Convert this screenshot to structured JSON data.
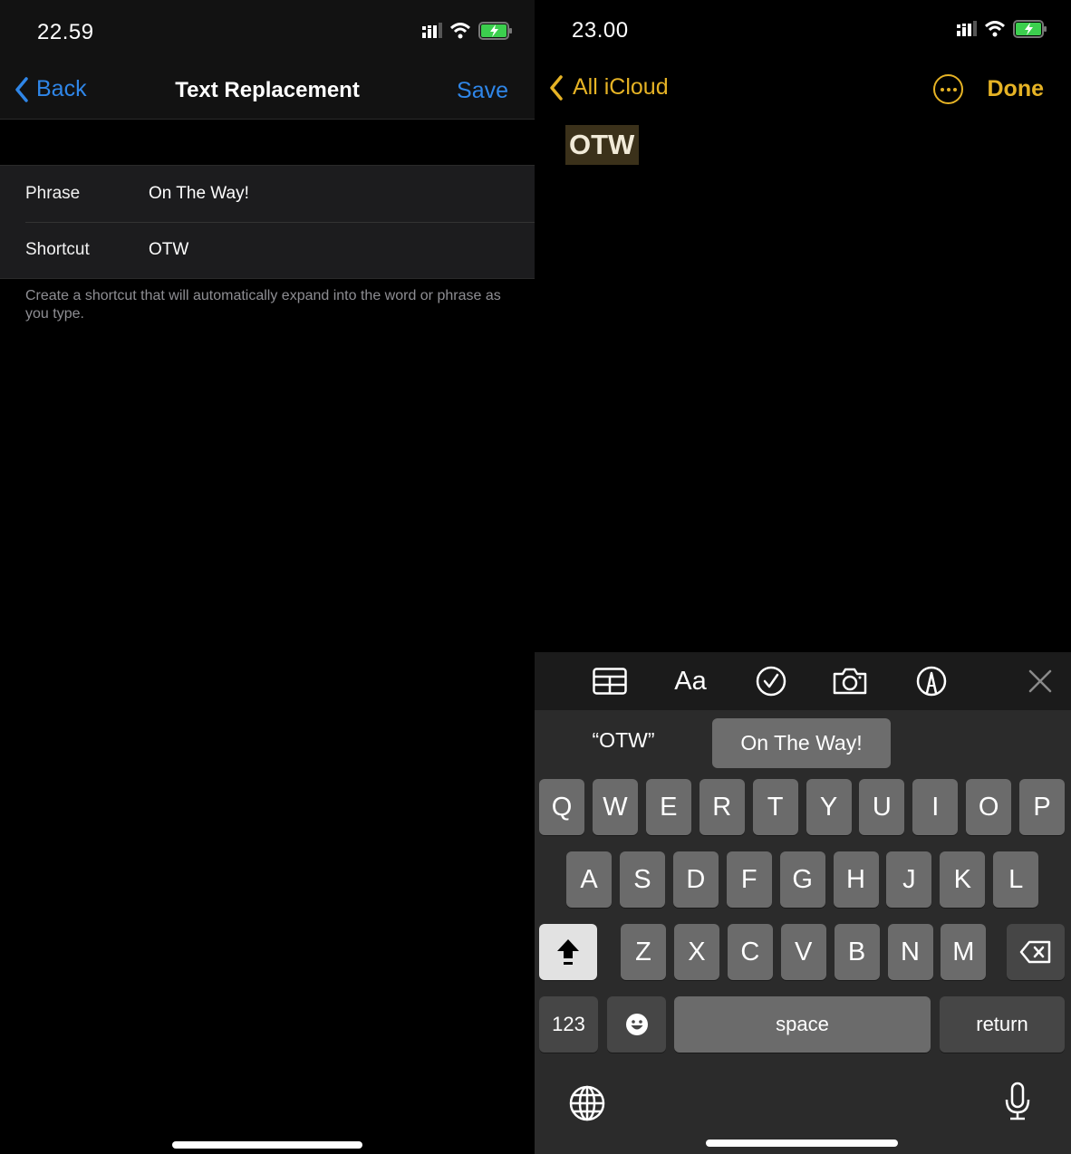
{
  "left": {
    "status": {
      "time": "22.59"
    },
    "nav": {
      "back_label": "Back",
      "title": "Text Replacement",
      "save_label": "Save"
    },
    "form": {
      "rows": [
        {
          "label": "Phrase",
          "value": "On The Way!"
        },
        {
          "label": "Shortcut",
          "value": "OTW"
        }
      ],
      "hint": "Create a shortcut that will automatically expand into the word or phrase as you type."
    },
    "accent_color": "#2f86e8"
  },
  "right": {
    "status": {
      "time": "23.00"
    },
    "nav": {
      "back_label": "All iCloud",
      "more_icon": "ellipsis-circle-icon",
      "done_label": "Done"
    },
    "note": {
      "text": "OTW"
    },
    "toolbar": {
      "icons": [
        "table-icon",
        "text-format-icon",
        "checklist-icon",
        "camera-icon",
        "markup-icon",
        "close-icon"
      ],
      "aa_label": "Aa"
    },
    "suggestions": {
      "original": "“OTW”",
      "replacement": "On The Way!"
    },
    "keyboard": {
      "row1": [
        "Q",
        "W",
        "E",
        "R",
        "T",
        "Y",
        "U",
        "I",
        "O",
        "P"
      ],
      "row2": [
        "A",
        "S",
        "D",
        "F",
        "G",
        "H",
        "J",
        "K",
        "L"
      ],
      "row3": [
        "Z",
        "X",
        "C",
        "V",
        "B",
        "N",
        "M"
      ],
      "numbers_label": "123",
      "space_label": "space",
      "return_label": "return"
    },
    "accent_color": "#e6b325"
  }
}
